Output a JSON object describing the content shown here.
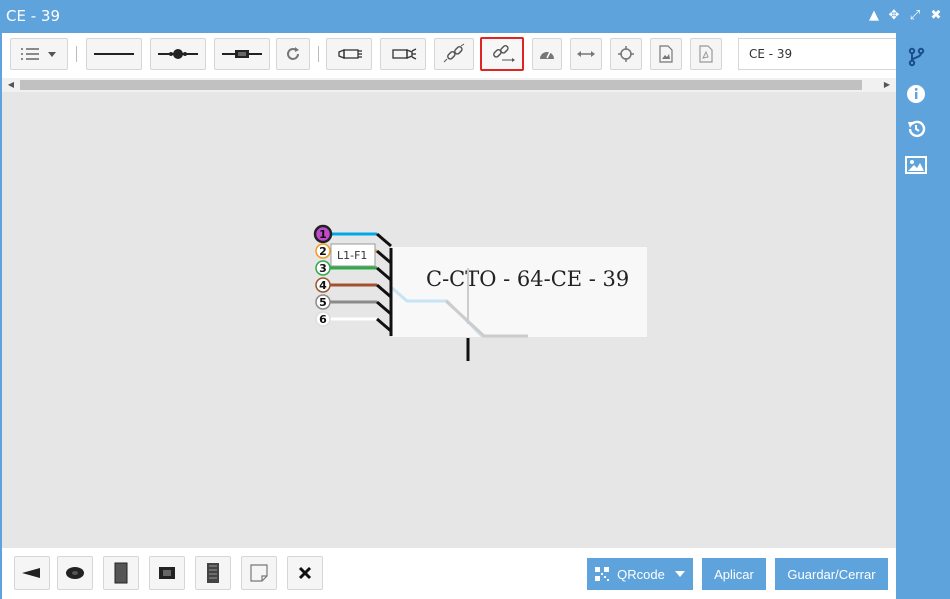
{
  "window": {
    "title": "CE - 39"
  },
  "title_controls": [
    {
      "name": "collapse-icon",
      "glyph": "▲"
    },
    {
      "name": "move-icon",
      "glyph": "✥"
    },
    {
      "name": "expand-icon",
      "glyph": "⤢"
    },
    {
      "name": "close-icon",
      "glyph": "✖"
    }
  ],
  "toolbar": {
    "title_value": "CE - 39",
    "selected_tool": "disconnect-tool-button"
  },
  "diagram": {
    "box_label": "C-CTO - 64-CE - 39",
    "tooltip": "L1-F1",
    "fibers": [
      {
        "num": "1",
        "color": "#00a8e8",
        "ring": "#c04ac9",
        "fill": "#c04ac9"
      },
      {
        "num": "2",
        "color": "#f59a23",
        "ring": "#f59a23",
        "fill": "#ffffff"
      },
      {
        "num": "3",
        "color": "#2eaa4a",
        "ring": "#2eaa4a",
        "fill": "#ffffff"
      },
      {
        "num": "4",
        "color": "#a0522d",
        "ring": "#a0522d",
        "fill": "#ffffff"
      },
      {
        "num": "5",
        "color": "#8a8a8a",
        "ring": "#8a8a8a",
        "fill": "#ffffff"
      },
      {
        "num": "6",
        "color": "#ffffff",
        "ring": "#dddddd",
        "fill": "#ffffff"
      }
    ]
  },
  "actions": {
    "qrcode": "QRcode",
    "apply": "Aplicar",
    "save_close": "Guardar/Cerrar"
  },
  "colors": {
    "accent": "#5fa3dc",
    "selected_border": "#e02424",
    "canvas": "#e6e6e6"
  }
}
